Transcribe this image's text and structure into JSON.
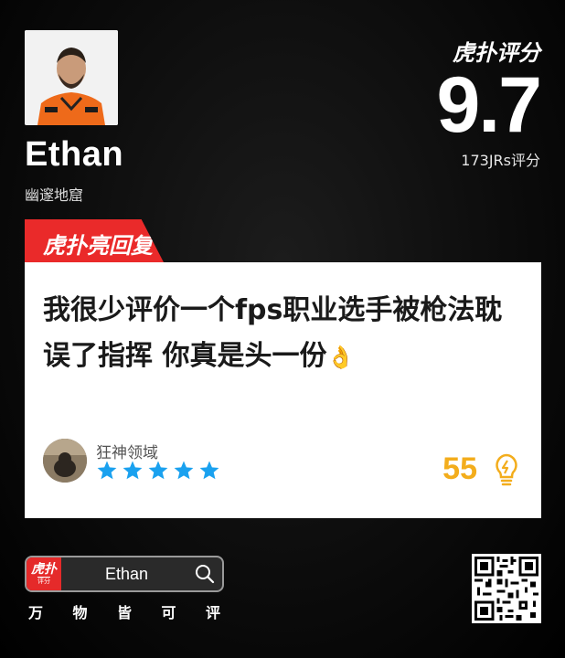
{
  "player": {
    "name": "Ethan",
    "team": "幽邃地窟"
  },
  "brand": {
    "logo_text": "虎扑评分",
    "app_logo_main": "虎扑",
    "app_logo_sub": "评分"
  },
  "score": {
    "value": "9.7",
    "count_label": "173JRs评分"
  },
  "tag": {
    "label": "虎扑亮回复"
  },
  "review": {
    "text": "我很少评价一个fps职业选手被枪法耽误了指挥 你真是头一份",
    "emoji": "👌",
    "reviewer_name": "狂神领域",
    "stars": 5,
    "likes": "55"
  },
  "search_bar": {
    "value": "Ethan"
  },
  "slogan": [
    "万",
    "物",
    "皆",
    "可",
    "评"
  ],
  "colors": {
    "accent_red": "#ea2a2a",
    "star_blue": "#1aa1ef",
    "likes_yellow": "#f3ad1c"
  }
}
